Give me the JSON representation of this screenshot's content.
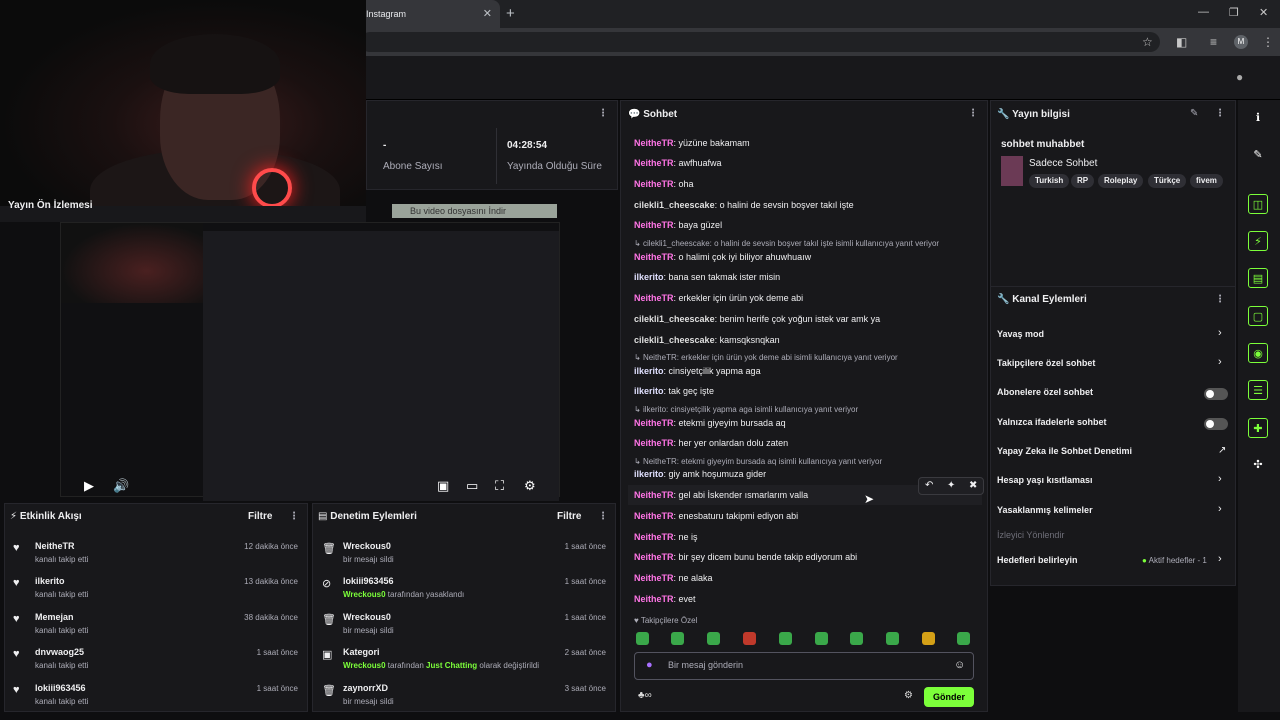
{
  "browser": {
    "tab_title": "Instagram",
    "tab_close": "✕",
    "new_tab": "+",
    "profile_initial": "M"
  },
  "webcam": {
    "label": "Yayın Ön İzlemesi"
  },
  "download_banner": "Bu video dosyasını İndir",
  "stats": {
    "abone_val": "-",
    "abone_label": "Abone Sayısı",
    "sure_val": "04:28:54",
    "sure_label": "Yayında Olduğu Süre"
  },
  "chat": {
    "title": "Sohbet",
    "messages": [
      {
        "user": "NeitheTR",
        "text": "yüzüne bakamam"
      },
      {
        "user": "NeitheTR",
        "text": "awfhuafwa"
      },
      {
        "user": "NeitheTR",
        "text": "oha"
      },
      {
        "user": "cilekli1_cheescake",
        "text": "o halini de sevsin boşver takıl işte"
      },
      {
        "user": "NeitheTR",
        "text": "baya güzel"
      },
      {
        "reply": "cilekli1_cheescake: o halini de sevsin boşver takıl işte isimli kullanıcıya yanıt veriyor"
      },
      {
        "user": "NeitheTR",
        "text": "o halimi çok iyi biliyor ahuwhuaıw"
      },
      {
        "user": "ilkerito",
        "text": "bana sen takmak ister misin"
      },
      {
        "user": "NeitheTR",
        "text": "erkekler için ürün yok deme abi"
      },
      {
        "user": "cilekli1_cheescake",
        "text": "benim herife çok yoğun istek var amk ya"
      },
      {
        "user": "cilekli1_cheescake",
        "text": "kamsqksnqkan"
      },
      {
        "reply": "NeitheTR: erkekler için ürün yok deme abi isimli kullanıcıya yanıt veriyor"
      },
      {
        "user": "ilkerito",
        "text": "cinsiyetçilik yapma aga"
      },
      {
        "user": "ilkerito",
        "text": "tak geç işte"
      },
      {
        "reply": "ilkerito: cinsiyetçilik yapma aga isimli kullanıcıya yanıt veriyor"
      },
      {
        "user": "NeitheTR",
        "text": "etekmi giyeyim bursada aq"
      },
      {
        "user": "NeitheTR",
        "text": "her yer onlardan dolu zaten"
      },
      {
        "reply": "NeitheTR: etekmi giyeyim bursada aq isimli kullanıcıya yanıt veriyor"
      },
      {
        "user": "ilkerito",
        "text": "giy amk hoşumuza gider"
      },
      {
        "user": "NeitheTR",
        "text": "gel abi İskender ısmarlarım valla"
      },
      {
        "user": "NeitheTR",
        "text": "enesbaturu takipmi ediyon abi"
      },
      {
        "user": "NeitheTR",
        "text": "ne iş"
      },
      {
        "user": "NeitheTR",
        "text": "bir şey dicem bunu bende takip ediyorum abi"
      },
      {
        "user": "NeitheTR",
        "text": "ne alaka"
      },
      {
        "user": "NeitheTR",
        "text": "evet"
      }
    ],
    "follower_label": "Takipçilere Özel",
    "input_placeholder": "Bir mesaj gönderin",
    "send_label": "Gönder"
  },
  "stream_info": {
    "title": "Yayın bilgisi",
    "stream_title": "sohbet muhabbet",
    "category": "Sadece Sohbet",
    "tags": [
      "Turkish",
      "RP",
      "Roleplay",
      "Türkçe",
      "fivem"
    ]
  },
  "channel_actions": {
    "title": "Kanal Eylemleri",
    "items": [
      {
        "label": "Yavaş mod",
        "control": "chevron"
      },
      {
        "label": "Takipçilere özel sohbet",
        "control": "chevron"
      },
      {
        "label": "Abonelere özel sohbet",
        "control": "toggle"
      },
      {
        "label": "Yalnızca ifadelerle sohbet",
        "control": "toggle"
      },
      {
        "label": "Yapay Zeka ile Sohbet Denetimi",
        "control": "external"
      },
      {
        "label": "Hesap yaşı kısıtlaması",
        "control": "chevron"
      },
      {
        "label": "Yasaklanmış kelimeler",
        "control": "chevron"
      },
      {
        "label": "İzleyici Yönlendir",
        "control": "none"
      },
      {
        "label": "Hedefleri belirleyin",
        "control": "chevron",
        "extra": "Aktif hedefler - 1"
      }
    ]
  },
  "activity": {
    "title": "Etkinlik Akışı",
    "filter": "Filtre",
    "rows": [
      {
        "name": "NeitheTR",
        "sub": "kanalı takip etti",
        "time": "12 dakika önce"
      },
      {
        "name": "ilkerito",
        "sub": "kanalı takip etti",
        "time": "13 dakika önce"
      },
      {
        "name": "Memejan",
        "sub": "kanalı takip etti",
        "time": "38 dakika önce"
      },
      {
        "name": "dnvwaog25",
        "sub": "kanalı takip etti",
        "time": "1 saat önce"
      },
      {
        "name": "lokiii963456",
        "sub": "kanalı takip etti",
        "time": "1 saat önce"
      }
    ]
  },
  "moderation": {
    "title": "Denetim Eylemleri",
    "filter": "Filtre",
    "rows": [
      {
        "icon": "trash-icon",
        "name": "Wreckous0",
        "sub": "bir mesajı sildi",
        "time": "1 saat önce"
      },
      {
        "icon": "ban-icon",
        "name": "lokiii963456",
        "actor": "Wreckous0",
        "sub": "tarafından yasaklandı",
        "time": "1 saat önce"
      },
      {
        "icon": "trash-icon",
        "name": "Wreckous0",
        "sub": "bir mesajı sildi",
        "time": "1 saat önce"
      },
      {
        "icon": "category-icon",
        "name": "Kategori",
        "actor": "Wreckous0",
        "sub": "tarafından",
        "target": "Just Chatting",
        "sub2": "olarak değiştirildi",
        "time": "2 saat önce"
      },
      {
        "icon": "trash-icon",
        "name": "zaynorrXD",
        "sub": "bir mesajı sildi",
        "time": "3 saat önce"
      }
    ]
  },
  "colors": {
    "accent": "#7cff3a",
    "bg": "#0e0e10",
    "panel": "#18181b",
    "username": "#ff75e6"
  }
}
